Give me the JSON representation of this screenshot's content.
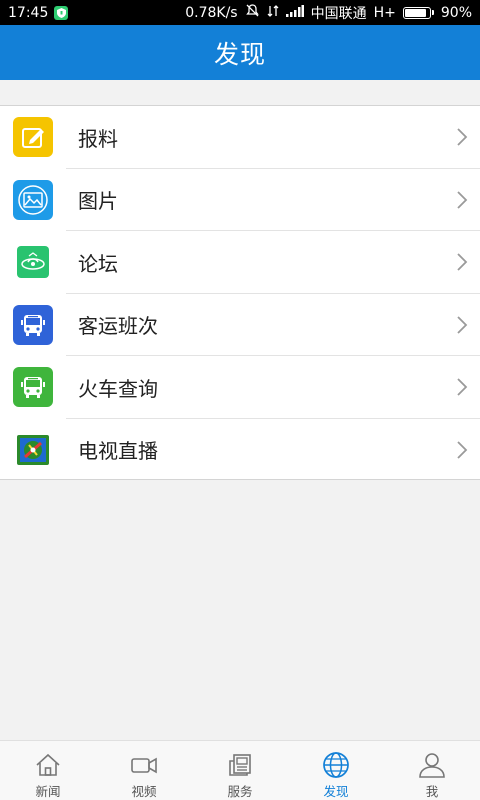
{
  "status_bar": {
    "time": "17:45",
    "net_speed": "0.78K/s",
    "carrier": "中国联通",
    "network": "H+",
    "battery": "90%",
    "battery_level": 0.9
  },
  "header": {
    "title": "发现"
  },
  "menu": {
    "items": [
      {
        "label": "报料",
        "icon": "edit-icon",
        "color": "#f5c400"
      },
      {
        "label": "图片",
        "icon": "image-icon",
        "color": "#1e9be8"
      },
      {
        "label": "论坛",
        "icon": "forum-icon",
        "color": "#29c36f"
      },
      {
        "label": "客运班次",
        "icon": "bus-icon",
        "color": "#2f63d8"
      },
      {
        "label": "火车查询",
        "icon": "train-icon",
        "color": "#3fb53c"
      },
      {
        "label": "电视直播",
        "icon": "tv-live-icon",
        "color": "#2b8a2b"
      }
    ]
  },
  "bottom_nav": {
    "items": [
      {
        "label": "新闻",
        "icon": "home-icon"
      },
      {
        "label": "视频",
        "icon": "video-icon"
      },
      {
        "label": "服务",
        "icon": "service-icon"
      },
      {
        "label": "发现",
        "icon": "globe-icon",
        "active": true
      },
      {
        "label": "我",
        "icon": "user-icon"
      }
    ]
  },
  "colors": {
    "accent": "#1380d7",
    "background": "#f2f2f2"
  }
}
